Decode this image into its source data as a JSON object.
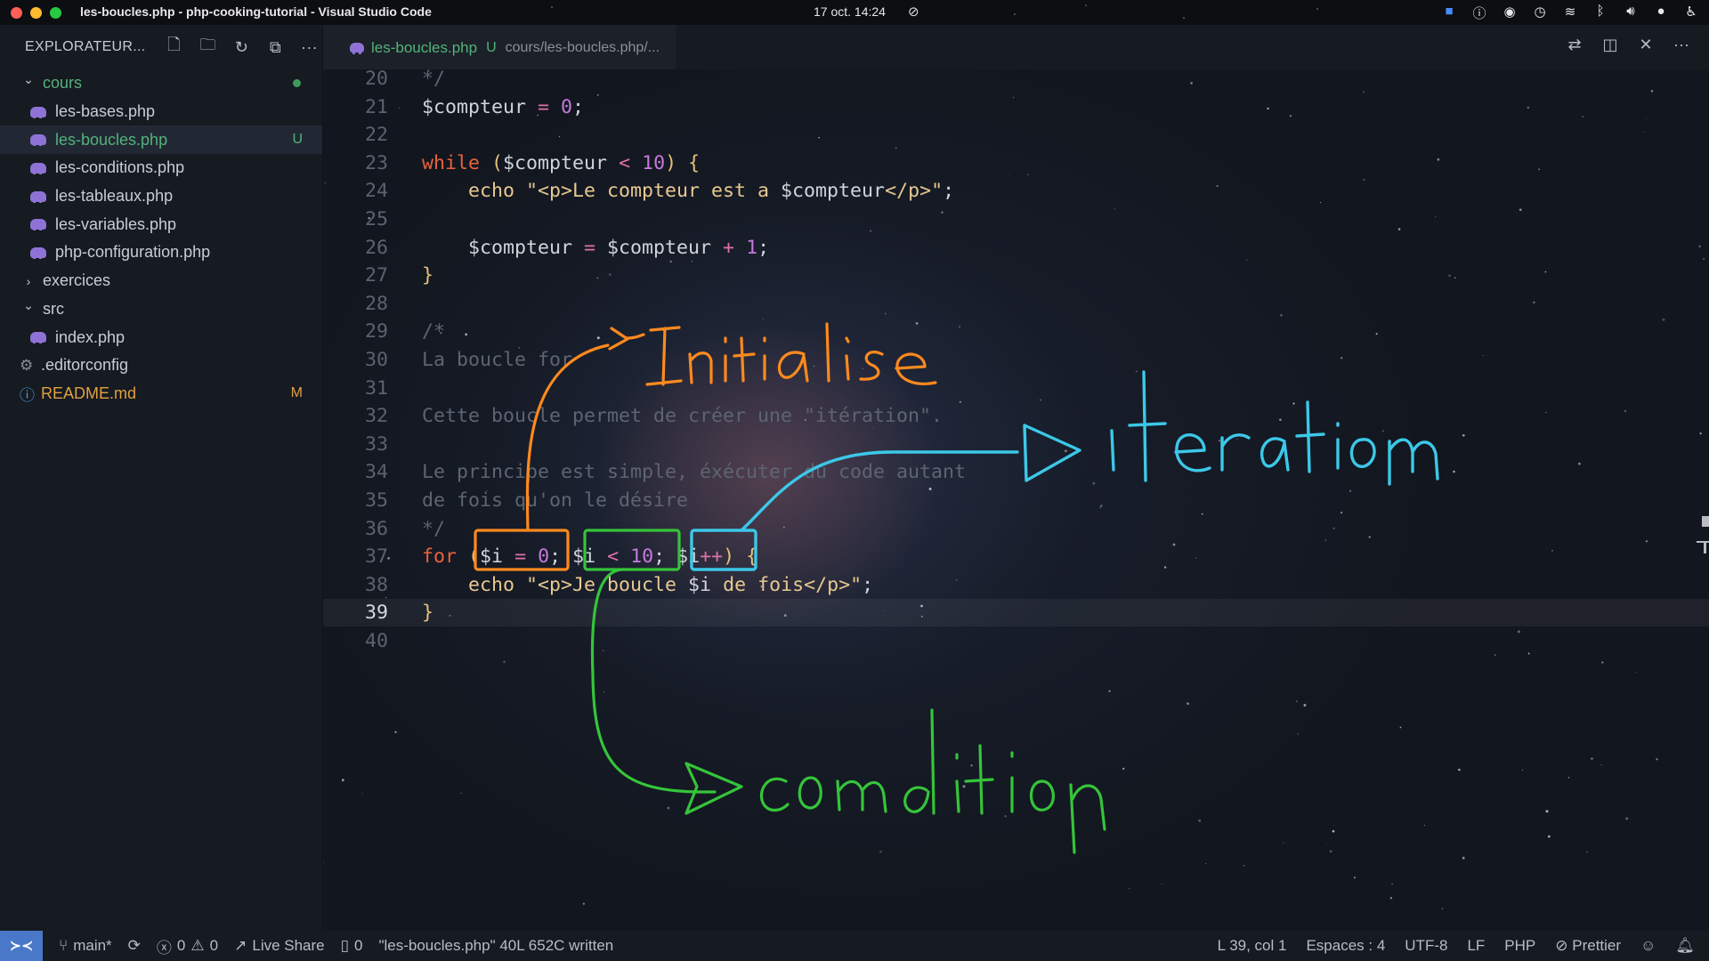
{
  "menubar": {
    "window_title": "les-boucles.php - php-cooking-tutorial - Visual Studio Code",
    "clock": "17 oct.  14:24",
    "traffic_colors": [
      "#ff5f57",
      "#febc2e",
      "#28c840"
    ],
    "tray_icons": [
      "zoom-icon",
      "info-icon",
      "chrome-icon",
      "timer-icon",
      "wifi-icon",
      "bluetooth-icon",
      "volume-icon",
      "mic-icon",
      "accessibility-icon"
    ]
  },
  "sidebar": {
    "title": "EXPLORATEUR...",
    "header_icons": [
      "new-file-icon",
      "new-folder-icon",
      "refresh-icon",
      "collapse-all-icon",
      "more-icon"
    ],
    "items": [
      {
        "label": "cours",
        "type": "folder",
        "expanded": true,
        "depth": 0,
        "color": "#52b37a",
        "dot": true
      },
      {
        "label": "les-bases.php",
        "type": "php",
        "depth": 1,
        "color": "#c8ccd4",
        "badge": ""
      },
      {
        "label": "les-boucles.php",
        "type": "php",
        "depth": 1,
        "color": "#52b37a",
        "badge": "U",
        "active": true
      },
      {
        "label": "les-conditions.php",
        "type": "php",
        "depth": 1,
        "color": "#c8ccd4",
        "badge": ""
      },
      {
        "label": "les-tableaux.php",
        "type": "php",
        "depth": 1,
        "color": "#c8ccd4",
        "badge": ""
      },
      {
        "label": "les-variables.php",
        "type": "php",
        "depth": 1,
        "color": "#c8ccd4",
        "badge": ""
      },
      {
        "label": "php-configuration.php",
        "type": "php",
        "depth": 1,
        "color": "#c8ccd4",
        "badge": ""
      },
      {
        "label": "exercices",
        "type": "folder",
        "expanded": false,
        "depth": 0,
        "color": "#c8ccd4"
      },
      {
        "label": "src",
        "type": "folder",
        "expanded": true,
        "depth": 0,
        "color": "#c8ccd4"
      },
      {
        "label": "index.php",
        "type": "php",
        "depth": 1,
        "color": "#c8ccd4",
        "badge": ""
      },
      {
        "label": ".editorconfig",
        "type": "gear",
        "depth": 0,
        "color": "#c8ccd4",
        "badge": ""
      },
      {
        "label": "README.md",
        "type": "info",
        "depth": 0,
        "color": "#e0a040",
        "badge": "M"
      }
    ]
  },
  "tab": {
    "name": "les-boucles.php",
    "status": "U",
    "path": "cours/les-boucles.php/..."
  },
  "editor_actions": [
    "compare-icon",
    "split-editor-icon",
    "close-icon",
    "more-icon"
  ],
  "code": {
    "current_line": 39,
    "lines": [
      {
        "n": "20",
        "tokens": [
          [
            "cmt",
            "*/"
          ]
        ]
      },
      {
        "n": "21",
        "tokens": [
          [
            "var",
            "$compteur"
          ],
          [
            "op",
            " = "
          ],
          [
            "num",
            "0"
          ],
          [
            "var",
            ";"
          ]
        ]
      },
      {
        "n": "22",
        "tokens": []
      },
      {
        "n": "23",
        "tokens": [
          [
            "kw",
            "while"
          ],
          [
            "var",
            " "
          ],
          [
            "br",
            "("
          ],
          [
            "var",
            "$compteur"
          ],
          [
            "op",
            " < "
          ],
          [
            "num",
            "10"
          ],
          [
            "br",
            ")"
          ],
          [
            "var",
            " "
          ],
          [
            "br",
            "{"
          ]
        ]
      },
      {
        "n": "24",
        "tokens": [
          [
            "var",
            "    "
          ],
          [
            "fn",
            "echo"
          ],
          [
            "str",
            " \"<p>Le compteur est a "
          ],
          [
            "var",
            "$compteur"
          ],
          [
            "str",
            "</p>\""
          ],
          [
            "var",
            ";"
          ]
        ]
      },
      {
        "n": "25",
        "tokens": []
      },
      {
        "n": "26",
        "tokens": [
          [
            "var",
            "    $compteur"
          ],
          [
            "op",
            " = "
          ],
          [
            "var",
            "$compteur"
          ],
          [
            "op",
            " + "
          ],
          [
            "num",
            "1"
          ],
          [
            "var",
            ";"
          ]
        ]
      },
      {
        "n": "27",
        "tokens": [
          [
            "br",
            "}"
          ]
        ]
      },
      {
        "n": "28",
        "tokens": []
      },
      {
        "n": "29",
        "tokens": [
          [
            "cmt",
            "/*"
          ]
        ]
      },
      {
        "n": "30",
        "tokens": [
          [
            "cmt",
            "La boucle for"
          ]
        ]
      },
      {
        "n": "31",
        "tokens": []
      },
      {
        "n": "32",
        "tokens": [
          [
            "cmt",
            "Cette boucle permet de créer une \"itération\"."
          ]
        ]
      },
      {
        "n": "33",
        "tokens": []
      },
      {
        "n": "34",
        "tokens": [
          [
            "cmt",
            "Le principe est simple, éxécuter du code autant"
          ]
        ]
      },
      {
        "n": "35",
        "tokens": [
          [
            "cmt",
            "de fois qu'on le désire"
          ]
        ]
      },
      {
        "n": "36",
        "tokens": [
          [
            "cmt",
            "*/"
          ]
        ]
      },
      {
        "n": "37",
        "tokens": [
          [
            "kw",
            "for"
          ],
          [
            "var",
            " "
          ],
          [
            "br",
            "("
          ],
          [
            "var",
            "$i"
          ],
          [
            "op",
            " = "
          ],
          [
            "num",
            "0"
          ],
          [
            "var",
            "; $i"
          ],
          [
            "op",
            " < "
          ],
          [
            "num",
            "10"
          ],
          [
            "var",
            "; $i"
          ],
          [
            "op",
            "++"
          ],
          [
            "br",
            ")"
          ],
          [
            "var",
            " "
          ],
          [
            "br",
            "{"
          ]
        ]
      },
      {
        "n": "38",
        "tokens": [
          [
            "var",
            "    "
          ],
          [
            "fn",
            "echo"
          ],
          [
            "str",
            " \"<p>Je boucle "
          ],
          [
            "var",
            "$i"
          ],
          [
            "str",
            " de fois</p>\""
          ],
          [
            "var",
            ";"
          ]
        ]
      },
      {
        "n": "39",
        "tokens": [
          [
            "br",
            "}"
          ]
        ]
      },
      {
        "n": "40",
        "tokens": []
      }
    ]
  },
  "annotations": {
    "colors": {
      "initialise": "#ff8a1e",
      "iteration": "#3cc8e8",
      "condition": "#35c43a"
    }
  },
  "statusbar": {
    "branch": "main*",
    "errors": "0",
    "warnings": "0",
    "live_share": "Live Share",
    "ports": "0",
    "message": "\"les-boucles.php\" 40L 652C written",
    "position": "L 39, col 1",
    "spaces": "Espaces : 4",
    "encoding": "UTF-8",
    "eol": "LF",
    "language": "PHP",
    "formatter": "Prettier"
  }
}
